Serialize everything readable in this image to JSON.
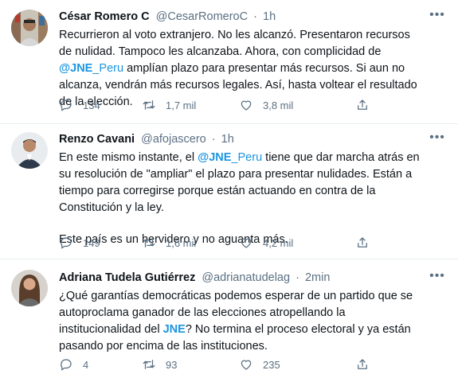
{
  "tweets": [
    {
      "name": "César Romero C",
      "handle": "@CesarRomeroC",
      "time": "1h",
      "text_a": "Recurrieron al voto extranjero. No les alcanzó. Presentaron recursos de nulidad. Tampoco les alcanzaba. Ahora, con complicidad de ",
      "mention_a": "@JNE_Peru",
      "mention_a_bold": "@JNE",
      "mention_a_rest": "_Peru",
      "text_b": " amplían plazo para presentar más recursos. Si aun no alcanza, vendrán más recursos legales. Así, hasta voltear el resultado de la elección.",
      "replies": "134",
      "retweets": "1,7 mil",
      "likes": "3,8 mil"
    },
    {
      "name": "Renzo Cavani",
      "handle": "@afojascero",
      "time": "1h",
      "text_a": "En este mismo instante, el ",
      "mention_a_bold": "@JNE",
      "mention_a_rest": "_Peru",
      "text_b": " tiene que dar marcha atrás en su resolución de \"ampliar\" el plazo para presentar nulidades. Están a tiempo para corregirse porque están actuando en contra de la Constitución y la ley.",
      "text_c": "Este país es un hervidero y no aguanta más.",
      "replies": "149",
      "retweets": "1,6 mil",
      "likes": "4,2 mil"
    },
    {
      "name": "Adriana Tudela Gutiérrez",
      "handle": "@adrianatudelag",
      "time": "2min",
      "text_a": "¿Qué garantías democráticas podemos esperar de un partido que se autoproclama ganador de las elecciones atropellando la institucionalidad del ",
      "mention_a_bold": "JNE",
      "text_b": "? No termina el proceso electoral y ya están pasando por encima de las instituciones.",
      "replies": "4",
      "retweets": "93",
      "likes": "235"
    }
  ],
  "icons": {
    "reply": "reply-icon",
    "retweet": "retweet-icon",
    "like": "heart-icon",
    "share": "share-icon",
    "more": "more-options-icon"
  },
  "colors": {
    "link": "#1b95e0",
    "muted": "#5b7083",
    "divider": "#e6ecf0"
  }
}
